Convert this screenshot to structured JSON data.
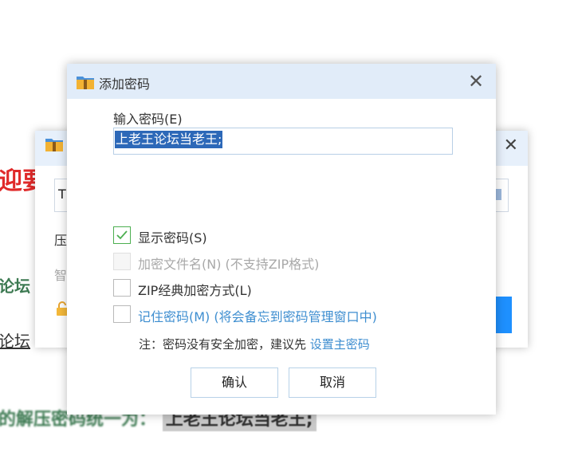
{
  "background": {
    "red_text": "迎要",
    "green_text": "论坛",
    "link_text": "论坛",
    "bottom_text_prefix": "的解压密码统一为：",
    "bottom_highlight": "上老王论坛当老王;"
  },
  "back_window": {
    "input_value": "T",
    "label_1": "压",
    "label_2": "智"
  },
  "dialog": {
    "title": "添加密码",
    "password_label": "输入密码(E)",
    "password_value": "上老王论坛当老王;",
    "options": {
      "show_password": {
        "label": "显示密码(S)",
        "checked": true
      },
      "encrypt_filenames": {
        "label": "加密文件名(N) (不支持ZIP格式)",
        "checked": false,
        "disabled": true
      },
      "zip_classic": {
        "label": "ZIP经典加密方式(L)",
        "checked": false
      },
      "remember_password": {
        "label": "记住密码(M) (将会备忘到密码管理窗口中)",
        "checked": false
      }
    },
    "note_text": "注：密码没有安全加密，建议先 ",
    "note_link": "设置主密码",
    "ok_label": "确认",
    "cancel_label": "取消"
  },
  "colors": {
    "title_bar": "#e1ecf9",
    "selection": "#2c68b8",
    "link_blue": "#3e8ed0",
    "check_green": "#4caf50"
  },
  "icons": [
    "folder-zip-icon",
    "close-icon",
    "check-icon",
    "lock-icon"
  ]
}
